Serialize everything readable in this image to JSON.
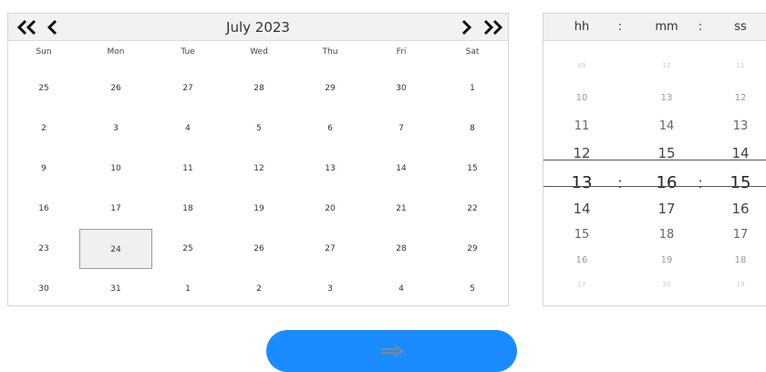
{
  "calendar": {
    "month_title": "July 2023",
    "weekdays": [
      "Sun",
      "Mon",
      "Tue",
      "Wed",
      "Thu",
      "Fri",
      "Sat"
    ],
    "weeks": [
      [
        "25",
        "26",
        "27",
        "28",
        "29",
        "30",
        "1"
      ],
      [
        "2",
        "3",
        "4",
        "5",
        "6",
        "7",
        "8"
      ],
      [
        "9",
        "10",
        "11",
        "12",
        "13",
        "14",
        "15"
      ],
      [
        "16",
        "17",
        "18",
        "19",
        "20",
        "21",
        "22"
      ],
      [
        "23",
        "24",
        "25",
        "26",
        "27",
        "28",
        "29"
      ],
      [
        "30",
        "31",
        "1",
        "2",
        "3",
        "4",
        "5"
      ]
    ],
    "selected_day": "24",
    "prev_year_icon": "double-chevron-left-icon",
    "prev_month_icon": "chevron-left-icon",
    "next_month_icon": "chevron-right-icon",
    "next_year_icon": "double-chevron-right-icon"
  },
  "time_picker": {
    "header": {
      "hh": "hh",
      "sep1": ":",
      "mm": "mm",
      "sep2": ":",
      "ss": "ss"
    },
    "hours": [
      "09",
      "10",
      "11",
      "12",
      "13",
      "14",
      "15",
      "16",
      "17"
    ],
    "minutes": [
      "12",
      "13",
      "14",
      "15",
      "16",
      "17",
      "18",
      "19",
      "20"
    ],
    "seconds": [
      "11",
      "12",
      "13",
      "14",
      "15",
      "16",
      "17",
      "18",
      "19"
    ],
    "selected": {
      "hh": "13",
      "mm": "16",
      "ss": "15",
      "sep": ":"
    }
  },
  "next_button": {
    "icon": "arrow-right-icon"
  },
  "colors": {
    "accent": "#1a8cff",
    "arrow": "#8a8a8a"
  }
}
